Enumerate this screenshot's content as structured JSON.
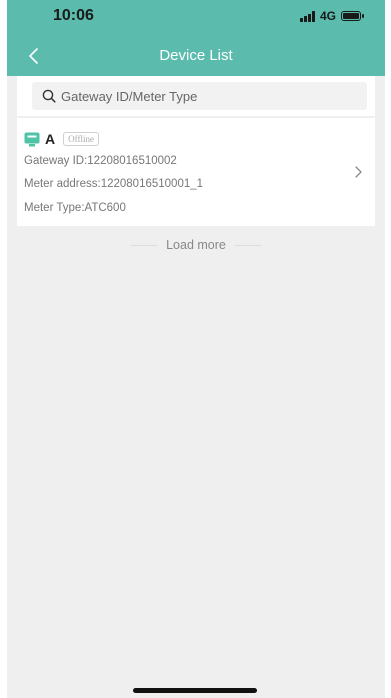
{
  "status_bar": {
    "time": "10:06",
    "network": "4G"
  },
  "nav": {
    "title": "Device List"
  },
  "search": {
    "placeholder": "Gateway ID/Meter Type",
    "value": ""
  },
  "devices": [
    {
      "name": "A",
      "status": "Offline",
      "gateway_id": "Gateway ID:12208016510002",
      "meter_address": "Meter address:12208016510001_1",
      "meter_type": "Meter Type:ATC600"
    }
  ],
  "load_more": {
    "label": "Load more"
  },
  "colors": {
    "accent": "#5bbcae",
    "device_icon": "#4fc3a7",
    "background": "#efefef"
  },
  "icons": [
    "back-chevron-icon",
    "search-icon",
    "device-icon",
    "chevron-right-icon",
    "signal-icon",
    "battery-icon"
  ]
}
